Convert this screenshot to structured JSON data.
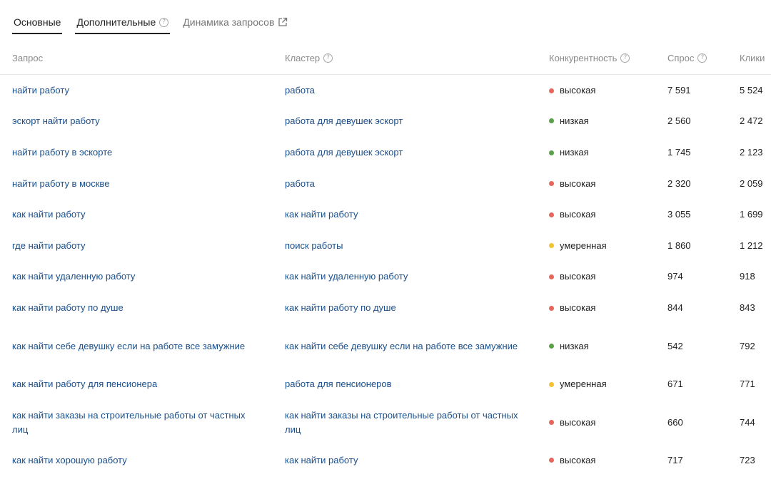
{
  "tabs": [
    {
      "label": "Основные",
      "active": true
    },
    {
      "label": "Дополнительные",
      "active": true
    },
    {
      "label": "Динамика запросов",
      "active": false
    }
  ],
  "columns": {
    "query": "Запрос",
    "cluster": "Кластер",
    "competition": "Конкурентность",
    "demand": "Спрос",
    "clicks": "Клики"
  },
  "level_colors": {
    "высокая": "#e5675b",
    "низкая": "#5aa046",
    "умеренная": "#f2c230"
  },
  "rows": [
    {
      "query": "найти работу",
      "cluster": "работа",
      "competition": "высокая",
      "demand": "7 591",
      "clicks": "5 524"
    },
    {
      "query": "эскорт найти работу",
      "cluster": "работа для девушек эскорт",
      "competition": "низкая",
      "demand": "2 560",
      "clicks": "2 472"
    },
    {
      "query": "найти работу в эскорте",
      "cluster": "работа для девушек эскорт",
      "competition": "низкая",
      "demand": "1 745",
      "clicks": "2 123"
    },
    {
      "query": "найти работу в москве",
      "cluster": "работа",
      "competition": "высокая",
      "demand": "2 320",
      "clicks": "2 059"
    },
    {
      "query": "как найти работу",
      "cluster": "как найти работу",
      "competition": "высокая",
      "demand": "3 055",
      "clicks": "1 699"
    },
    {
      "query": "где найти работу",
      "cluster": "поиск работы",
      "competition": "умеренная",
      "demand": "1 860",
      "clicks": "1 212"
    },
    {
      "query": "как найти удаленную работу",
      "cluster": "как найти удаленную работу",
      "competition": "высокая",
      "demand": "974",
      "clicks": "918"
    },
    {
      "query": "как найти работу по душе",
      "cluster": "как найти работу по душе",
      "competition": "высокая",
      "demand": "844",
      "clicks": "843"
    },
    {
      "query": "как найти себе девушку если на работе все замужние",
      "cluster": "как найти себе девушку если на работе все замужние",
      "competition": "низкая",
      "demand": "542",
      "clicks": "792"
    },
    {
      "query": "как найти работу для пенсионера",
      "cluster": "работа для пенсионеров",
      "competition": "умеренная",
      "demand": "671",
      "clicks": "771"
    },
    {
      "query": "как найти заказы на строительные работы от частных лиц",
      "cluster": "как найти заказы на строительные работы от частных лиц",
      "competition": "высокая",
      "demand": "660",
      "clicks": "744"
    },
    {
      "query": "как найти хорошую работу",
      "cluster": "как найти работу",
      "competition": "высокая",
      "demand": "717",
      "clicks": "723"
    }
  ]
}
